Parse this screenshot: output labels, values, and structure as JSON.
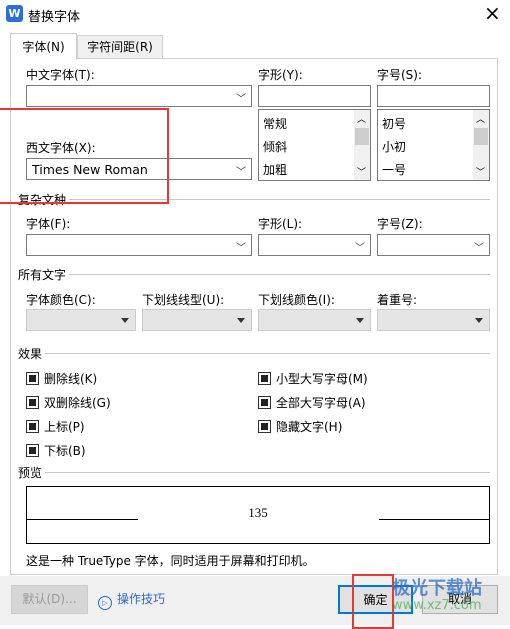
{
  "window": {
    "title": "替换字体",
    "app_icon": "wps-writer-icon",
    "close": "×"
  },
  "tabs": [
    {
      "label": "字体(N)",
      "active": true
    },
    {
      "label": "字符间距(R)",
      "active": false
    }
  ],
  "font": {
    "chinese_font_label": "中文字体(T):",
    "chinese_font_value": "",
    "style_label": "字形(Y):",
    "style_value": "",
    "style_options": [
      "常规",
      "倾斜",
      "加粗"
    ],
    "size_label": "字号(S):",
    "size_value": "",
    "size_options": [
      "初号",
      "小初",
      "一号"
    ],
    "western_font_label": "西文字体(X):",
    "western_font_value": "Times New Roman"
  },
  "complex": {
    "group": "复杂文种",
    "font_label": "字体(F):",
    "style_label": "字形(L):",
    "size_label": "字号(Z):"
  },
  "all_text": {
    "group": "所有文字",
    "color_label": "字体颜色(C):",
    "underline_label": "下划线线型(U):",
    "underline_color_label": "下划线颜色(I):",
    "emphasis_label": "着重号:"
  },
  "effects": {
    "group": "效果",
    "left": [
      "删除线(K)",
      "双删除线(G)",
      "上标(P)",
      "下标(B)"
    ],
    "right": [
      "小型大写字母(M)",
      "全部大写字母(A)",
      "隐藏文字(H)"
    ]
  },
  "preview": {
    "group": "预览",
    "sample": "135",
    "note": "这是一种 TrueType 字体，同时适用于屏幕和打印机。"
  },
  "footer": {
    "default_label": "默认(D)...",
    "tips_label": "操作技巧",
    "ok_label": "确定",
    "cancel_label": "取消"
  },
  "watermark": {
    "text": "极光下载站",
    "url": "www.xz7.com"
  },
  "colors": {
    "highlight": "#e53935",
    "link": "#2a6cc4",
    "primary_border": "#0078d7"
  }
}
